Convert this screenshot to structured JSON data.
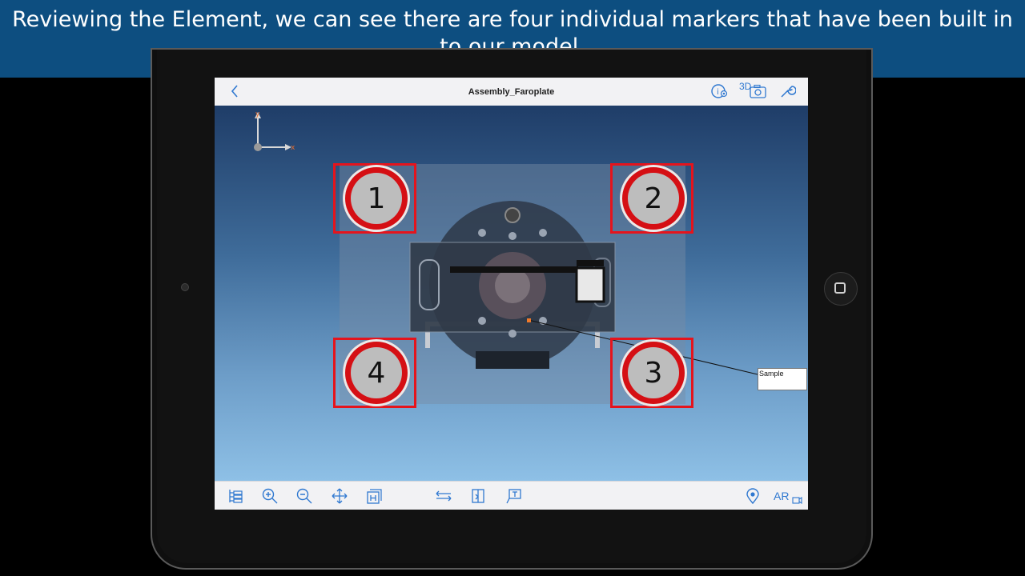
{
  "caption": {
    "text": "Reviewing the Element, we can see there are four individual markers that have been built in to our model."
  },
  "app": {
    "title": "Assembly_Faroplate",
    "back_label": "<",
    "toolbar_3d_label": "3D",
    "ar_label": "AR"
  },
  "axes": {
    "x_label": "x",
    "y_label": "y"
  },
  "markers": [
    {
      "number": "1"
    },
    {
      "number": "2"
    },
    {
      "number": "3"
    },
    {
      "number": "4"
    }
  ],
  "annotation": {
    "label": "Sample"
  },
  "colors": {
    "caption_bg": "#0d4e80",
    "accent": "#2f78d0",
    "marker_red": "#e5141c"
  },
  "icons": {
    "top_right": [
      "info-icon",
      "3d-camera-icon",
      "wrench-icon"
    ],
    "bottom_left": [
      "tree-icon",
      "zoom-in-icon",
      "zoom-out-icon",
      "pan-icon",
      "fit-view-icon"
    ],
    "bottom_center": [
      "measure-icon",
      "section-icon",
      "text-annotation-icon"
    ],
    "bottom_right": [
      "location-pin-icon",
      "ar-camera-icon"
    ]
  }
}
